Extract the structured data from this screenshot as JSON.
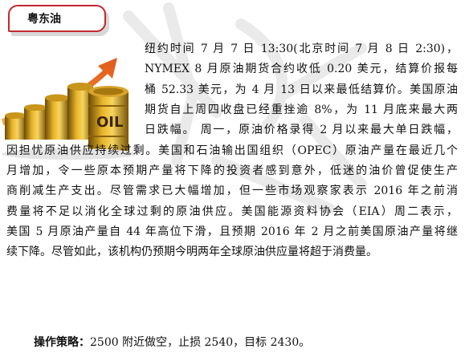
{
  "tag": {
    "label": "粤东油"
  },
  "image": {
    "barrel_label": "OIL"
  },
  "article": {
    "lines": [
      "纽约时间 7 月 7 日 13:30(北京时间 7 月 8 日 2:30)，",
      "NYMEX 8 月原油期货合约收低 0.20 美元，结算价报每",
      "桶 52.33 美元，为 4 月 13 日以来最低结算价。美国原油",
      "期货自上周四收盘已经重挫逾 8%，为 11 月底来最大两",
      "日跌幅。 周一，原油价格录得 2 月以来最大单日跌幅，",
      "因担忧原油供应持续过剩。美国和石油输出国组织（OPEC）原油产量在最近几个",
      "月增加，令一些原本预期产量将下降的投资者感到意外，低迷的油价曾促使生产",
      "商削减生产支出。尽管需求已大幅增加，但一些市场观察家表示 2016 年之前消",
      "费量将不足以消化全球过剩的原油供应。美国能源资料协会（EIA）周二表示，",
      "美国 5 月原油产量自 44 年高位下滑，且预期 2016 年 2 月之前美国原油产量将继",
      "续下降。尽管如此，该机构仍预期今明两年全球原油供应量将超于消费量。"
    ]
  },
  "strategy": {
    "label": "操作策略：",
    "text": "2500 附近做空，止损 2540，目标 2430。"
  }
}
